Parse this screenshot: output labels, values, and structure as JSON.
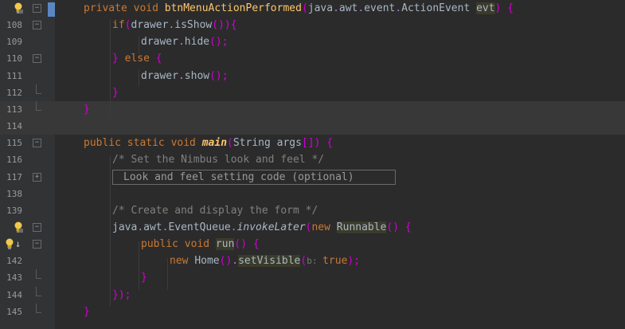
{
  "editor": {
    "lines": [
      {
        "num": "",
        "tokens": [
          {
            "t": "private void ",
            "c": "kw"
          },
          {
            "t": "btnMenuActionPerformed",
            "c": "fn"
          },
          {
            "t": "(",
            "c": "pn"
          },
          {
            "t": "java",
            "c": "mt"
          },
          {
            "t": ".",
            "c": "dot"
          },
          {
            "t": "awt",
            "c": "mt"
          },
          {
            "t": ".",
            "c": "dot"
          },
          {
            "t": "event",
            "c": "mt"
          },
          {
            "t": ".",
            "c": "dot"
          },
          {
            "t": "ActionEvent ",
            "c": "mt"
          },
          {
            "t": "evt",
            "c": "sel"
          },
          {
            "t": ")",
            "c": "pn"
          },
          {
            "t": " {",
            "c": "pn"
          }
        ]
      },
      {
        "num": "108",
        "tokens": [
          {
            "t": "if",
            "c": "kw"
          },
          {
            "t": "(",
            "c": "pn"
          },
          {
            "t": "drawer",
            "c": "mt"
          },
          {
            "t": ".",
            "c": "dot"
          },
          {
            "t": "isShow",
            "c": "mt"
          },
          {
            "t": "()){",
            "c": "pn"
          }
        ]
      },
      {
        "num": "109",
        "tokens": [
          {
            "t": "drawer",
            "c": "mt"
          },
          {
            "t": ".",
            "c": "dot"
          },
          {
            "t": "hide",
            "c": "mt"
          },
          {
            "t": "();",
            "c": "pn"
          }
        ]
      },
      {
        "num": "110",
        "tokens": [
          {
            "t": "} ",
            "c": "pn"
          },
          {
            "t": "else",
            "c": "kw"
          },
          {
            "t": " {",
            "c": "pn"
          }
        ]
      },
      {
        "num": "111",
        "tokens": [
          {
            "t": "drawer",
            "c": "mt"
          },
          {
            "t": ".",
            "c": "dot"
          },
          {
            "t": "show",
            "c": "mt"
          },
          {
            "t": "();",
            "c": "pn"
          }
        ]
      },
      {
        "num": "112",
        "tokens": [
          {
            "t": "}",
            "c": "pn"
          }
        ]
      },
      {
        "num": "113",
        "tokens": [
          {
            "t": "}",
            "c": "pn"
          }
        ]
      },
      {
        "num": "114",
        "tokens": []
      },
      {
        "num": "115",
        "tokens": [
          {
            "t": "public static void ",
            "c": "kw"
          },
          {
            "t": "main",
            "c": "fni"
          },
          {
            "t": "(",
            "c": "pn"
          },
          {
            "t": "String args",
            "c": "mt"
          },
          {
            "t": "[]",
            "c": "pn"
          },
          {
            "t": ") {",
            "c": "pn"
          }
        ]
      },
      {
        "num": "116",
        "tokens": [
          {
            "t": "/* Set the Nimbus look and feel */",
            "c": "cm"
          }
        ]
      },
      {
        "num": "117",
        "fold_text": "Look and feel setting code (optional)"
      },
      {
        "num": "138",
        "tokens": []
      },
      {
        "num": "139",
        "tokens": [
          {
            "t": "/* Create and display the form */",
            "c": "cm"
          }
        ]
      },
      {
        "num": "",
        "tokens": [
          {
            "t": "java",
            "c": "mt"
          },
          {
            "t": ".",
            "c": "dot"
          },
          {
            "t": "awt",
            "c": "mt"
          },
          {
            "t": ".",
            "c": "dot"
          },
          {
            "t": "EventQueue",
            "c": "mt"
          },
          {
            "t": ".",
            "c": "dot"
          },
          {
            "t": "invokeLater",
            "c": "it"
          },
          {
            "t": "(",
            "c": "pn"
          },
          {
            "t": "new ",
            "c": "kw"
          },
          {
            "t": "Runnable",
            "c": "sel"
          },
          {
            "t": "() {",
            "c": "pn"
          }
        ]
      },
      {
        "num": "",
        "tokens": [
          {
            "t": "public void ",
            "c": "kw"
          },
          {
            "t": "run",
            "c": "sel"
          },
          {
            "t": "() {",
            "c": "pn"
          }
        ]
      },
      {
        "num": "142",
        "tokens": [
          {
            "t": "new ",
            "c": "kw"
          },
          {
            "t": "Home",
            "c": "mt"
          },
          {
            "t": "()",
            "c": "pn"
          },
          {
            "t": ".",
            "c": "dot"
          },
          {
            "t": "setVisible",
            "c": "sel"
          },
          {
            "t": "(",
            "c": "pn"
          },
          {
            "t": "b: ",
            "c": "hint"
          },
          {
            "t": "true",
            "c": "kw"
          },
          {
            "t": ");",
            "c": "pn"
          }
        ]
      },
      {
        "num": "143",
        "tokens": [
          {
            "t": "}",
            "c": "pn"
          }
        ]
      },
      {
        "num": "144",
        "tokens": [
          {
            "t": "});",
            "c": "pn"
          }
        ]
      },
      {
        "num": "145",
        "tokens": [
          {
            "t": "}",
            "c": "pn"
          }
        ]
      }
    ]
  },
  "colors": {
    "background": "#2b2b2b",
    "gutter": "#313335",
    "keyword": "#cc7832",
    "method_decl": "#ffc66d",
    "comment": "#808080",
    "punctuation": "#d300d3"
  }
}
